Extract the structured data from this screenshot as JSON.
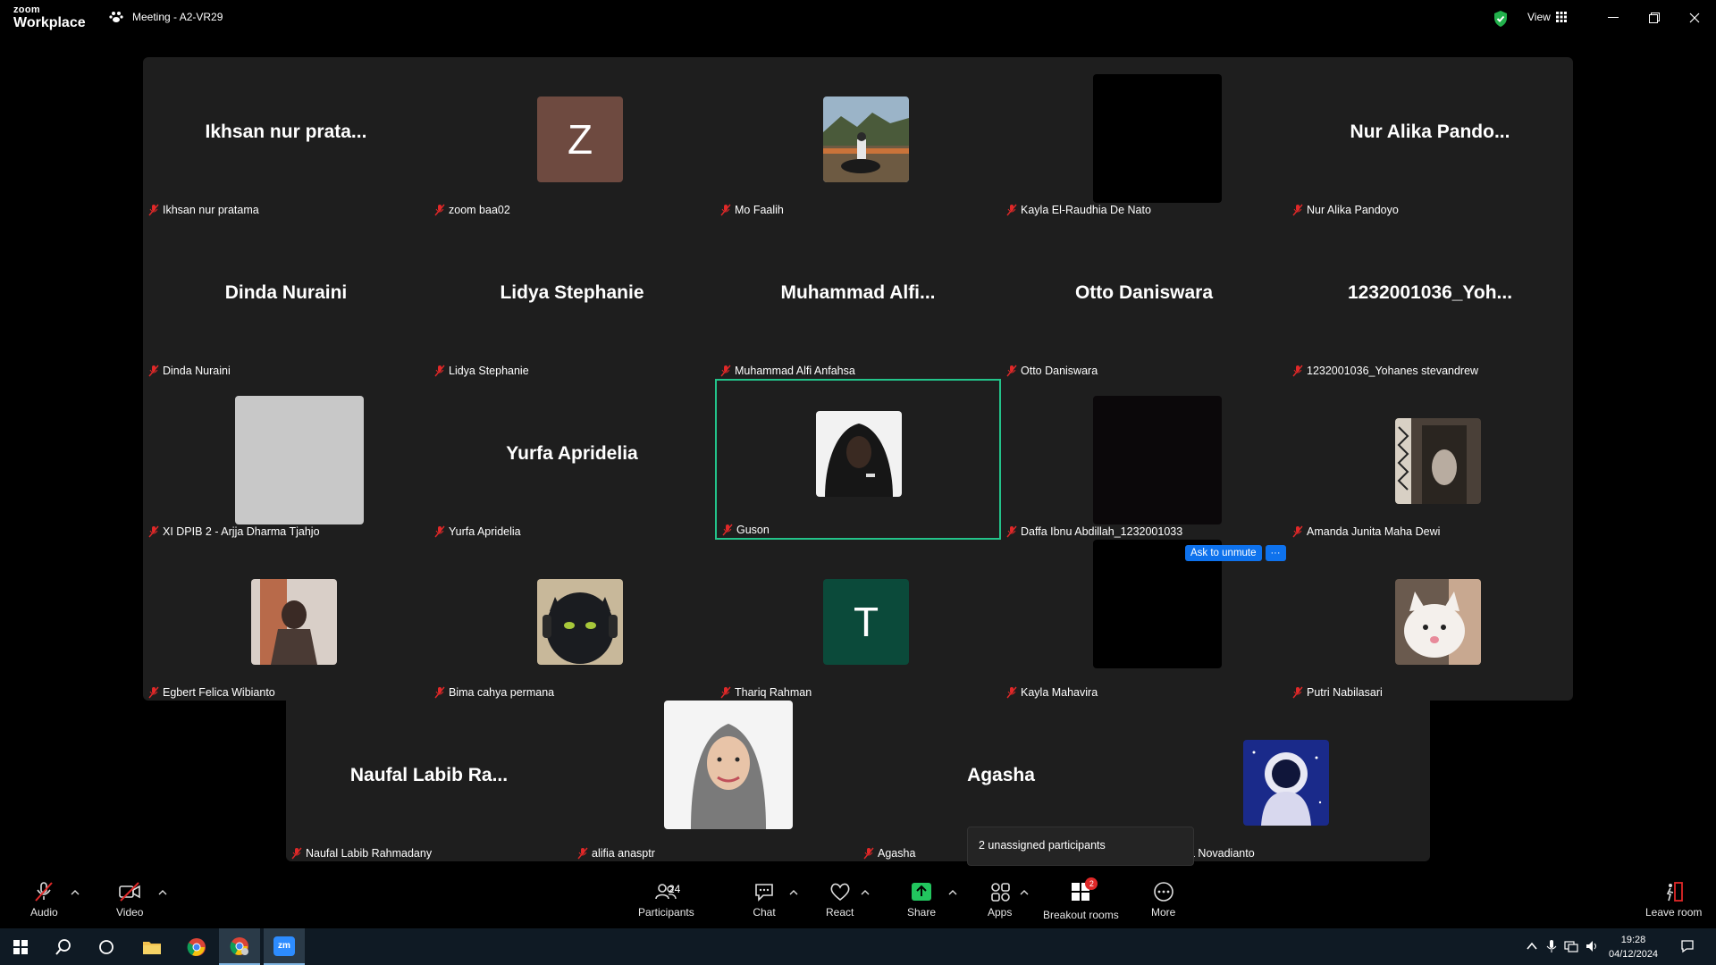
{
  "window": {
    "logo_top": "zoom",
    "logo_bottom": "Workplace",
    "meeting_title": "Meeting - A2-VR29",
    "view_label": "View",
    "shield_color": "#22b14c"
  },
  "tiles": [
    {
      "name": "Ikhsan nur pratama",
      "big": "Ikhsan nur prata..."
    },
    {
      "name": "zoom baa02",
      "letter": "Z",
      "color": "#6e4a40"
    },
    {
      "name": "Mo Faalih",
      "photo": "landscape-motorbike"
    },
    {
      "name": "Kayla El-Raudhia De Nato",
      "photo": "black"
    },
    {
      "name": "Nur Alika Pandoyo",
      "big": "Nur  Alika  Pando..."
    },
    {
      "name": "Dinda Nuraini",
      "big": "Dinda Nuraini"
    },
    {
      "name": "Lidya Stephanie",
      "big": "Lidya Stephanie"
    },
    {
      "name": "Muhammad Alfi Anfahsa",
      "big": "Muhammad  Alfi..."
    },
    {
      "name": "Otto Daniswara",
      "big": "Otto Daniswara"
    },
    {
      "name": "1232001036_Yohanes stevandrew",
      "big": "1232001036_Yoh..."
    },
    {
      "name": "XI DPIB 2 - Arjja Dharma Tjahjo",
      "photo": "gray"
    },
    {
      "name": "Yurfa Apridelia",
      "big": "Yurfa Apridelia"
    },
    {
      "name": "Guson",
      "photo": "hoodie"
    },
    {
      "name": "Daffa Ibnu Abdillah_1232001033",
      "photo": "dark"
    },
    {
      "name": "Amanda Junita Maha Dewi",
      "photo": "room"
    },
    {
      "name": "Egbert Felica Wibianto",
      "photo": "selfie"
    },
    {
      "name": "Bima cahya permana",
      "photo": "toothless"
    },
    {
      "name": "Thariq Rahman",
      "letter": "T",
      "color": "#0b4a3a"
    },
    {
      "name": "Kayla Mahavira",
      "photo": "black"
    },
    {
      "name": "Putri Nabilasari",
      "photo": "cat"
    },
    {
      "name": "Naufal Labib Rahmadany",
      "big": "Naufal  Labib  Ra..."
    },
    {
      "name": "alifia anasptr",
      "photo": "hijab"
    },
    {
      "name": "Agasha",
      "big": "Agasha"
    },
    {
      "name": "a Novadianto",
      "photo": "astronaut"
    }
  ],
  "overlay": {
    "ask_to_unmute": "Ask to unmute",
    "more_dots": "···",
    "unassigned_popup": "2 unassigned participants"
  },
  "toolbar": {
    "audio": "Audio",
    "video": "Video",
    "participants": "Participants",
    "participants_count": "24",
    "chat": "Chat",
    "react": "React",
    "share": "Share",
    "apps": "Apps",
    "breakout": "Breakout rooms",
    "breakout_badge": "2",
    "more": "More",
    "leave": "Leave room",
    "share_color": "#22c55e",
    "leave_color": "#e02828"
  },
  "taskbar": {
    "time": "19:28",
    "date": "04/12/2024",
    "zoom_icon": "zm"
  }
}
